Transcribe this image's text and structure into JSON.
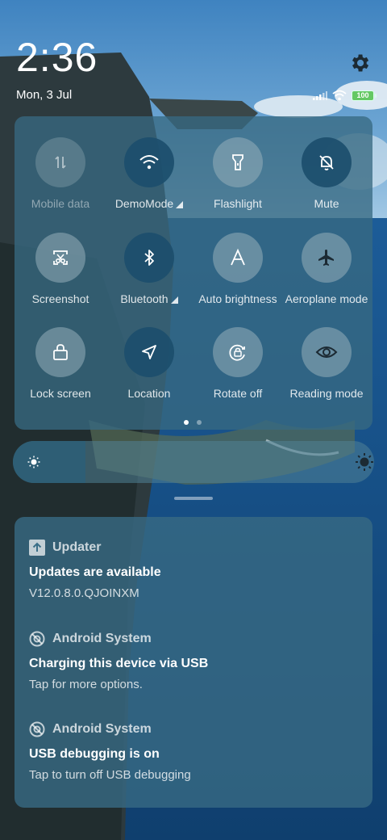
{
  "status_bar": {
    "time": "2:36",
    "date": "Mon, 3 Jul",
    "battery_level": "100",
    "icons": [
      "signal-icon",
      "wifi-icon",
      "battery-icon"
    ]
  },
  "header": {
    "settings_icon": "gear-icon"
  },
  "quick_settings": {
    "tiles": [
      {
        "label": "Mobile data",
        "icon": "mobile-data-icon",
        "state": "disabled"
      },
      {
        "label": "DemoMode",
        "icon": "wifi-icon",
        "state": "on",
        "has_menu": true
      },
      {
        "label": "Flashlight",
        "icon": "flashlight-icon",
        "state": "off"
      },
      {
        "label": "Mute",
        "icon": "bell-off-icon",
        "state": "on"
      },
      {
        "label": "Screenshot",
        "icon": "screenshot-icon",
        "state": "off"
      },
      {
        "label": "Bluetooth",
        "icon": "bluetooth-icon",
        "state": "on",
        "has_menu": true
      },
      {
        "label": "Auto brightness",
        "icon": "auto-brightness-icon",
        "state": "off"
      },
      {
        "label": "Aeroplane mode",
        "icon": "airplane-icon",
        "state": "off"
      },
      {
        "label": "Lock screen",
        "icon": "lock-icon",
        "state": "off"
      },
      {
        "label": "Location",
        "icon": "location-icon",
        "state": "on"
      },
      {
        "label": "Rotate off",
        "icon": "rotate-lock-icon",
        "state": "off"
      },
      {
        "label": "Reading mode",
        "icon": "eye-icon",
        "state": "off"
      }
    ],
    "pages": 2,
    "current_page": 1
  },
  "brightness": {
    "level": 0.2
  },
  "notifications": [
    {
      "app": "Updater",
      "app_icon": "update-arrow-icon",
      "title": "Updates are available",
      "body": "V12.0.8.0.QJOINXM"
    },
    {
      "app": "Android System",
      "app_icon": "android-system-icon",
      "title": "Charging this device via USB",
      "body": "Tap for more options."
    },
    {
      "app": "Android System",
      "app_icon": "android-system-icon",
      "title": "USB debugging is on",
      "body": "Tap to turn off USB debugging"
    }
  ],
  "colors": {
    "tile_on": "#1c4e6c",
    "tile_off": "#96afb9",
    "panel": "#376982",
    "battery": "#64c864"
  }
}
